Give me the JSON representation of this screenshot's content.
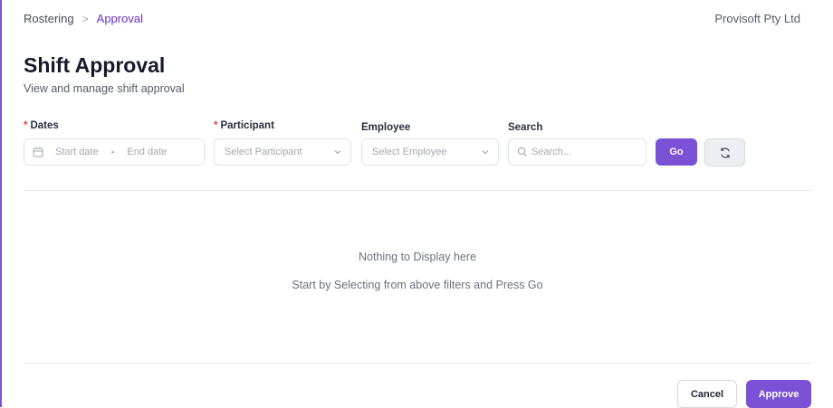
{
  "breadcrumb": {
    "items": [
      "Rostering",
      "Approval"
    ],
    "separator": ">"
  },
  "company": "Provisoft Pty Ltd",
  "page": {
    "title": "Shift Approval",
    "subtitle": "View and manage shift approval"
  },
  "filters": {
    "dates": {
      "label": "Dates",
      "required_marker": "*",
      "start_placeholder": "Start date",
      "separator": "-",
      "end_placeholder": "End date",
      "icon": "calendar-icon"
    },
    "participant": {
      "label": "Participant",
      "required_marker": "*",
      "placeholder": "Select Participant",
      "icon": "chevron-down-icon"
    },
    "employee": {
      "label": "Employee",
      "placeholder": "Select Employee",
      "icon": "chevron-down-icon"
    },
    "search": {
      "label": "Search",
      "placeholder": "Search...",
      "icon": "search-icon"
    },
    "go_label": "Go",
    "reset_icon": "refresh-icon"
  },
  "empty_state": {
    "title": "Nothing to Display here",
    "subtitle": "Start by Selecting from above filters and Press Go"
  },
  "footer": {
    "cancel_label": "Cancel",
    "approve_label": "Approve"
  },
  "colors": {
    "accent": "#7b52d6",
    "breadcrumb_active": "#6b2fc9",
    "required": "#e5484d",
    "border": "#dfe2e8"
  }
}
